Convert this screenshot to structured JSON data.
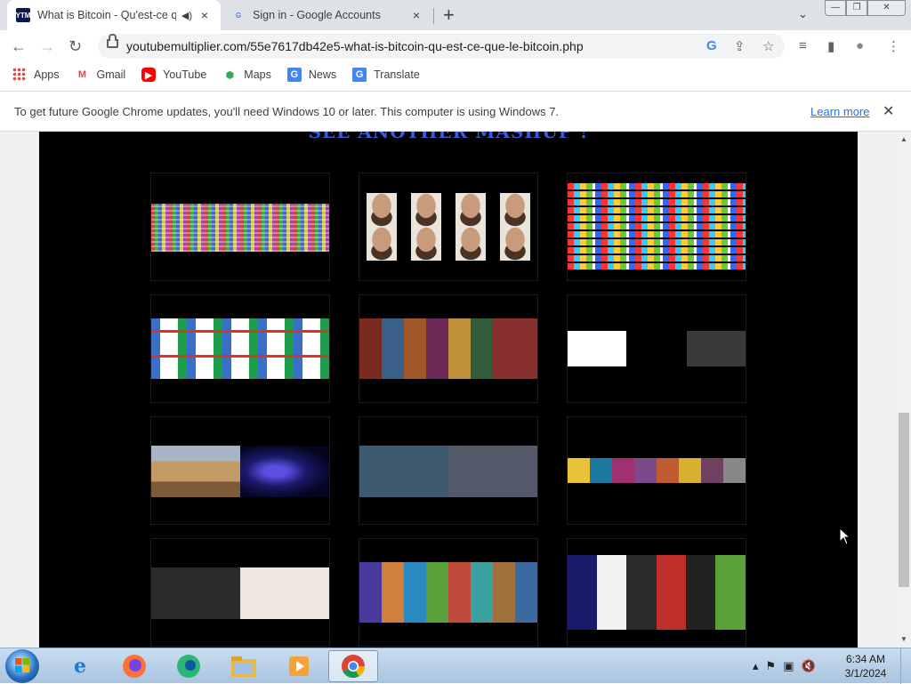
{
  "browser": {
    "tabs": [
      {
        "favicon": "YTM",
        "title": "What is Bitcoin - Qu'est-ce q",
        "speaker": "speaker-icon",
        "close": "×",
        "active": true
      },
      {
        "favicon": "G",
        "title": "Sign in - Google Accounts",
        "close": "×",
        "active": false
      }
    ],
    "new_tab": "+",
    "tab_search": "⌄",
    "window_controls": {
      "minimize": "—",
      "maximize": "❐",
      "close": "✕"
    },
    "nav": {
      "back": "←",
      "forward": "→",
      "reload": "↻"
    },
    "address": "youtubemultiplier.com/55e7617db42e5-what-is-bitcoin-qu-est-ce-que-le-bitcoin.php",
    "omni_icons": {
      "google_lens": "G",
      "share": "⇪",
      "star": "☆"
    },
    "toolbar_icons": {
      "media": "≡",
      "sidepanel": "▮",
      "profile": "●",
      "menu": "⋮"
    }
  },
  "bookmarks": [
    {
      "label": "Apps",
      "icon": "apps-grid-icon"
    },
    {
      "label": "Gmail",
      "icon": "gmail-icon",
      "glyph": "M"
    },
    {
      "label": "YouTube",
      "icon": "youtube-icon",
      "glyph": "▶"
    },
    {
      "label": "Maps",
      "icon": "maps-icon",
      "glyph": "⬢"
    },
    {
      "label": "News",
      "icon": "news-icon",
      "glyph": "G"
    },
    {
      "label": "Translate",
      "icon": "translate-icon",
      "glyph": "G"
    }
  ],
  "infobar": {
    "message": "To get future Google Chrome updates, you'll need Windows 10 or later. This computer is using Windows 7.",
    "link": "Learn more",
    "close": "✕"
  },
  "content": {
    "heading": "SEE ANOTHER MASHUP !"
  },
  "taskbar": {
    "apps": [
      "internet-explorer-icon",
      "firefox-icon",
      "edge-icon",
      "file-explorer-icon",
      "media-player-icon",
      "chrome-icon"
    ],
    "clock": {
      "time": "6:34 AM",
      "date": "3/1/2024"
    },
    "tray": {
      "chevron": "▴",
      "flag": "⚑",
      "network": "▣",
      "volume": "🔇"
    }
  },
  "colors": {
    "tab_strip": "#dee1e6",
    "link": "#1a73e8",
    "heading": "#3b5bd6",
    "page_bg": "#000000"
  }
}
